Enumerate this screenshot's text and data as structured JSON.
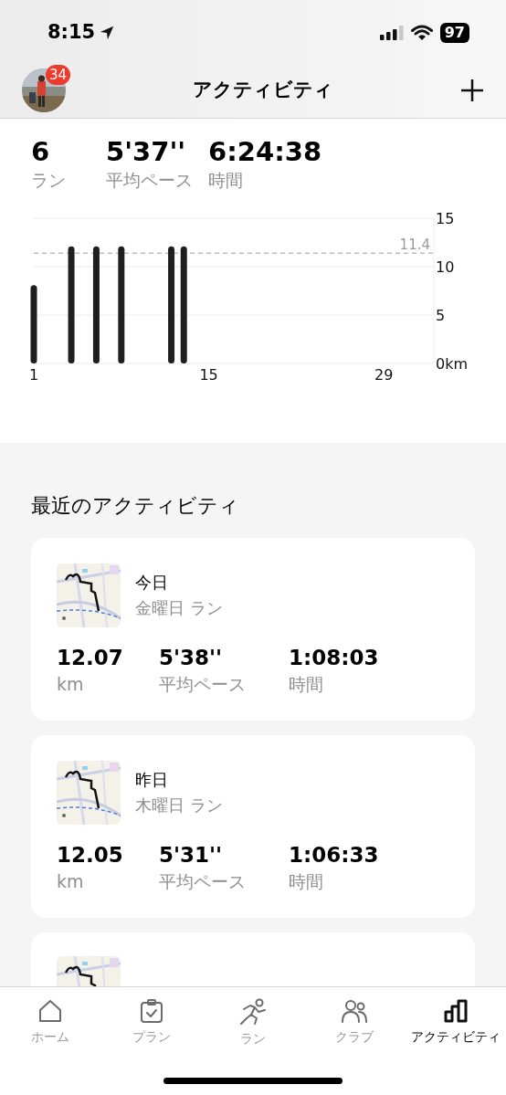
{
  "status_bar": {
    "time": "8:15",
    "battery": "97"
  },
  "header": {
    "title": "アクティビティ",
    "badge": "34"
  },
  "summary": [
    {
      "value": "6",
      "label": "ラン"
    },
    {
      "value": "5'37''",
      "label": "平均ペース"
    },
    {
      "value": "6:24:38",
      "label": "時間"
    }
  ],
  "chart_data": {
    "type": "bar",
    "x": [
      1,
      4,
      6,
      8,
      12,
      13
    ],
    "values": [
      8.1,
      12.1,
      12.1,
      12.1,
      12.1,
      12.1
    ],
    "xlim": [
      1,
      33
    ],
    "ylim": [
      0,
      15
    ],
    "xticks": [
      1,
      15,
      29
    ],
    "yticks": [
      {
        "value": 0,
        "label": "0km"
      },
      5,
      10,
      15
    ],
    "ref_lines": [
      {
        "axis": "y",
        "value": 11.4,
        "label": "11.4"
      }
    ]
  },
  "recent": {
    "title": "最近のアクティビティ",
    "activities": [
      {
        "day": "今日",
        "subtitle": "金曜日 ラン",
        "stats": [
          {
            "value": "12.07",
            "label": "km"
          },
          {
            "value": "5'38''",
            "label": "平均ペース"
          },
          {
            "value": "1:08:03",
            "label": "時間"
          }
        ]
      },
      {
        "day": "昨日",
        "subtitle": "木曜日 ラン",
        "stats": [
          {
            "value": "12.05",
            "label": "km"
          },
          {
            "value": "5'31''",
            "label": "平均ペース"
          },
          {
            "value": "1:06:33",
            "label": "時間"
          }
        ]
      },
      {
        "kind": "partial"
      }
    ]
  },
  "tab_bar": [
    {
      "label": "ホーム",
      "selected": false
    },
    {
      "label": "プラン",
      "selected": false
    },
    {
      "label": "ラン",
      "selected": false
    },
    {
      "label": "クラブ",
      "selected": false
    },
    {
      "label": "アクティビティ",
      "selected": true
    }
  ]
}
